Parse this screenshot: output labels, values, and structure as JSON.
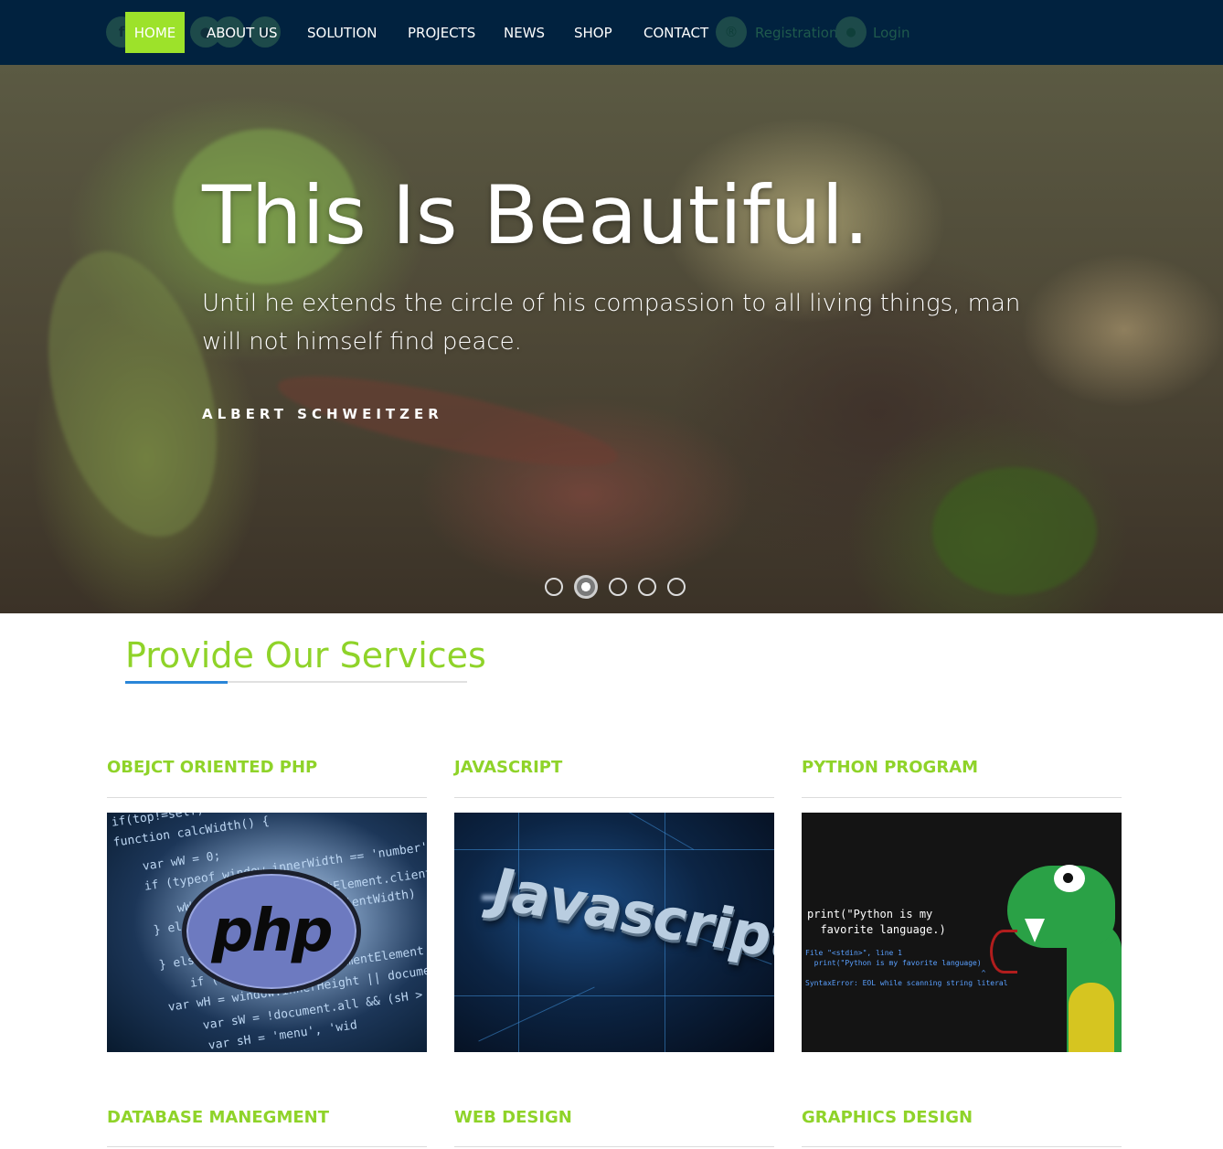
{
  "nav": {
    "social": [
      {
        "icon": "facebook-icon",
        "glyph": "f"
      },
      {
        "icon": "user-icon",
        "glyph": "●"
      },
      {
        "icon": "user-icon",
        "glyph": "●"
      },
      {
        "icon": "user-icon",
        "glyph": "●"
      },
      {
        "icon": "user-icon",
        "glyph": "●"
      }
    ],
    "home": "HOME",
    "about": "ABOUT US",
    "solution": "SOLUTION",
    "projects": "PROJECTS",
    "news": "NEWS",
    "shop": "SHOP",
    "contact": "CONTACT",
    "registration": "Registration",
    "registration_icon": "registered-icon",
    "registration_glyph": "®",
    "login": "Login",
    "login_icon": "user-icon",
    "login_glyph": "●"
  },
  "hero": {
    "title": "This Is Beautiful.",
    "quote": "Until he extends the circle of his compassion to all living things, man will not himself find peace.",
    "author": "ALBERT SCHWEITZER",
    "slides": 5,
    "active_slide": 2
  },
  "services": {
    "title": "Provide Our Services",
    "cards": [
      {
        "title": "OBEJCT ORIENTED PHP",
        "image": "php-logo"
      },
      {
        "title": "JAVASCRIPT",
        "image": "javascript-logo"
      },
      {
        "title": "PYTHON PROGRAM",
        "image": "python-snake-puppet"
      },
      {
        "title": "DATABASE MANEGMENT"
      },
      {
        "title": "WEB DESIGN"
      },
      {
        "title": "GRAPHICS DESIGN"
      }
    ]
  },
  "images": {
    "php": {
      "logo_text": "php",
      "code": [
        "if(top!=self)",
        "function calcWidth() {",
        "var wW = 0;",
        "if (typeof window.innerWidth == 'number') {",
        "wW = document.documentElement.clientWidth;",
        "} else if (document.body.clientWidth)",
        "} else {",
        "if (sH = document.documentElement.scrollHe",
        "var wH = window.innerHeight || document",
        "var sW = !document.all && (sH > wH)",
        "var sH = 'menu', 'wid"
      ]
    },
    "javascript": {
      "logo_text": "Javascript"
    },
    "python": {
      "print_line1": "print(\"Python is my",
      "print_line2": "  favorite language.)",
      "err_line1": "File \"<stdin>\", line 1",
      "err_line2": "  print(\"Python is my favorite language)",
      "err_line3": "                                        ^",
      "syntax_error": "SyntaxError: EOL while scanning string literal"
    }
  },
  "colors": {
    "nav_bg": "#01223f",
    "accent_green": "#9de22a",
    "title_green": "#8fd329",
    "underline_blue": "#2a86d8"
  }
}
